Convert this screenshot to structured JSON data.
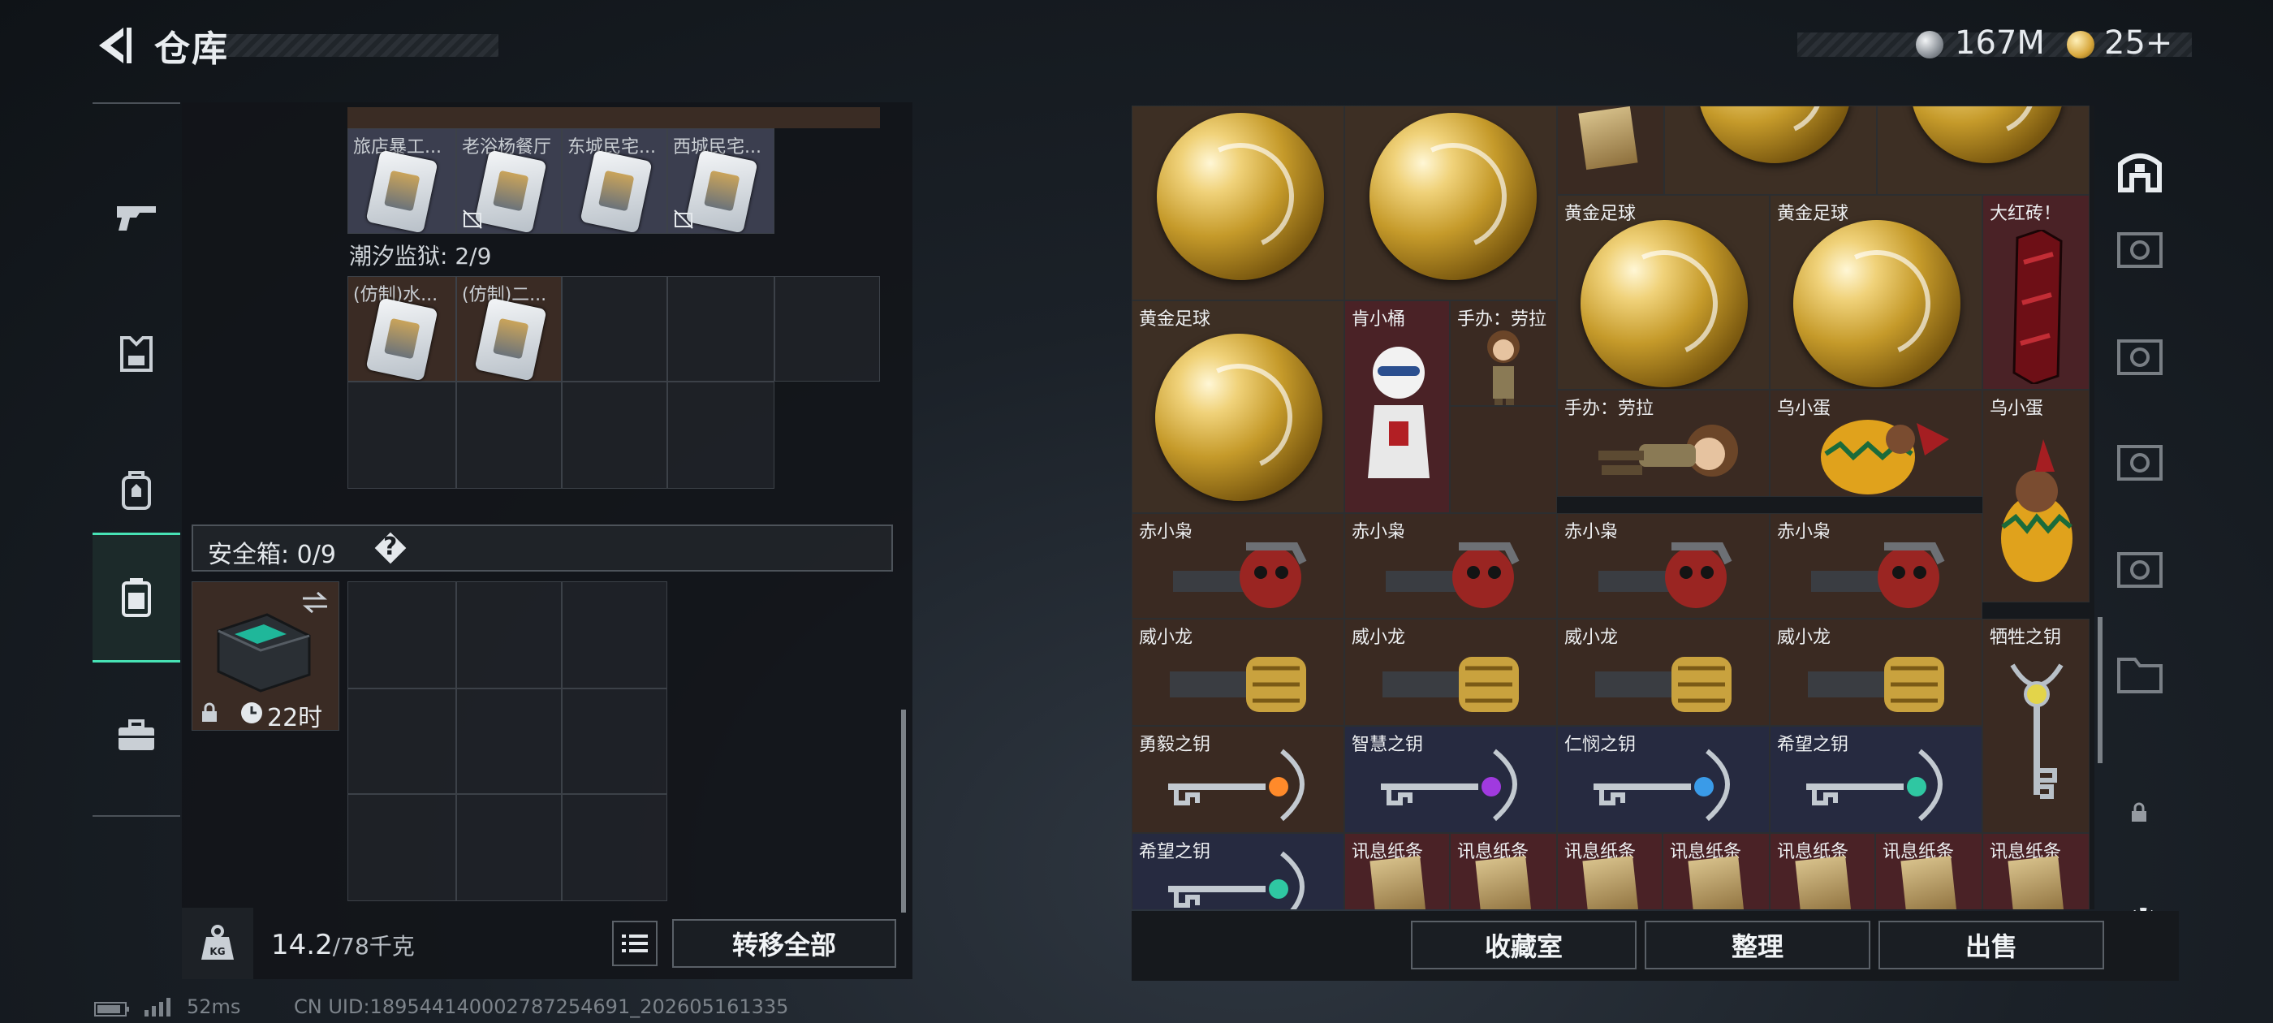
{
  "header": {
    "title": "仓库",
    "currency_1": "167M",
    "currency_2": "25+"
  },
  "left_tabs": [
    "gun-icon",
    "armor-icon",
    "backpack-icon",
    "safe-box-icon",
    "toolbox-icon"
  ],
  "stash": {
    "top_items": [
      {
        "name": "旅店暴工..."
      },
      {
        "name": "老浴杨餐厅"
      },
      {
        "name": "东城民宅..."
      },
      {
        "name": "西城民宅..."
      }
    ],
    "prison_label": "潮汐监狱: 2/9",
    "prison_items": [
      {
        "name": "(仿制)水..."
      },
      {
        "name": "(仿制)二..."
      }
    ],
    "safe_box_label": "安全箱: 0/9",
    "safe_box_help": "?",
    "safe_box_time": "22时"
  },
  "bottom": {
    "weight_current": "14.2",
    "weight_max": "/78千克",
    "transfer_all": "转移全部",
    "collection": "收藏室",
    "organize": "整理",
    "sell": "出售"
  },
  "inventory": {
    "golden_ball": "黄金足球",
    "big_red_brick": "大红砖！",
    "kfc_bucket": "肯小桶",
    "lara_figure": "手办：劳拉",
    "lara_figure_2": "手办：劳拉",
    "egg": "乌小蛋",
    "egg_2": "乌小蛋",
    "chixiao": "赤小枭",
    "weixiao": "威小龙",
    "sacrifice_key": "牺牲之钥",
    "courage_key": "勇毅之钥",
    "wisdom_key": "智慧之钥",
    "mercy_key": "仁悯之钥",
    "hope_key": "希望之钥",
    "hope_key_2": "希望之钥",
    "note": "讯息纸条"
  },
  "footer": {
    "ping": "52ms",
    "uid": "CN UID:18954414000278725469​1_202605161335"
  },
  "colors": {
    "accent": "#47e3b5",
    "gold_bg": "#3d2f24",
    "red_bg": "#4a2226",
    "blue_bg": "#262a40",
    "brown_bg": "#3a2a22"
  }
}
